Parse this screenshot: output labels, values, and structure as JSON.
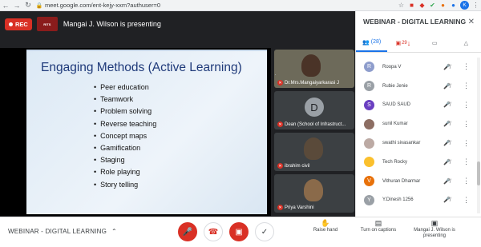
{
  "browser": {
    "url": "meet.google.com/ent-kejy-xxm?authuser=0",
    "profile_initial": "K"
  },
  "meeting": {
    "rec_label": "REC",
    "presenting_text": "Mangai J. Wilson is presenting",
    "logo_text": "RITS"
  },
  "slide": {
    "title": "Engaging Methods (Active Learning)",
    "bullets": [
      "Peer education",
      "Teamwork",
      "Problem solving",
      "Reverse teaching",
      "Concept maps",
      "Gamification",
      "Staging",
      "Role playing",
      "Story telling"
    ]
  },
  "tiles": [
    {
      "name": "Dr.Mrs.Mangaiyarkarasi J"
    },
    {
      "name": "Dean (School of Infrastruct...",
      "letter": "D"
    },
    {
      "name": "ibrahim civil"
    },
    {
      "name": "Priya Varshini"
    }
  ],
  "panel": {
    "title": "WEBINAR - DIGITAL LEARNING",
    "people_count": "(28)",
    "chat_badge": "29",
    "participants": [
      {
        "initial": "R",
        "name": "Roopa V",
        "color": "#8e9dcc"
      },
      {
        "initial": "R",
        "name": "Rubie Jenie",
        "color": "#9aa0a6"
      },
      {
        "initial": "S",
        "name": "SAUD SAUD",
        "color": "#6a3fc1"
      },
      {
        "initial": "",
        "name": "sunil Kumar",
        "color": "#8d6e63"
      },
      {
        "initial": "",
        "name": "swathi sivasankar",
        "color": "#bcaaa4"
      },
      {
        "initial": "",
        "name": "Tech Rocky",
        "color": "#fbc02d"
      },
      {
        "initial": "V",
        "name": "Vithuran Dharmar",
        "color": "#e8710a"
      },
      {
        "initial": "Y",
        "name": "Y.Dinesh 1256",
        "color": "#9aa0a6"
      }
    ]
  },
  "bottombar": {
    "meeting_title": "WEBINAR - DIGITAL LEARNING",
    "raise_hand": "Raise hand",
    "captions": "Turn on captions",
    "presenting": "Mangai J. Wilson is presenting"
  }
}
